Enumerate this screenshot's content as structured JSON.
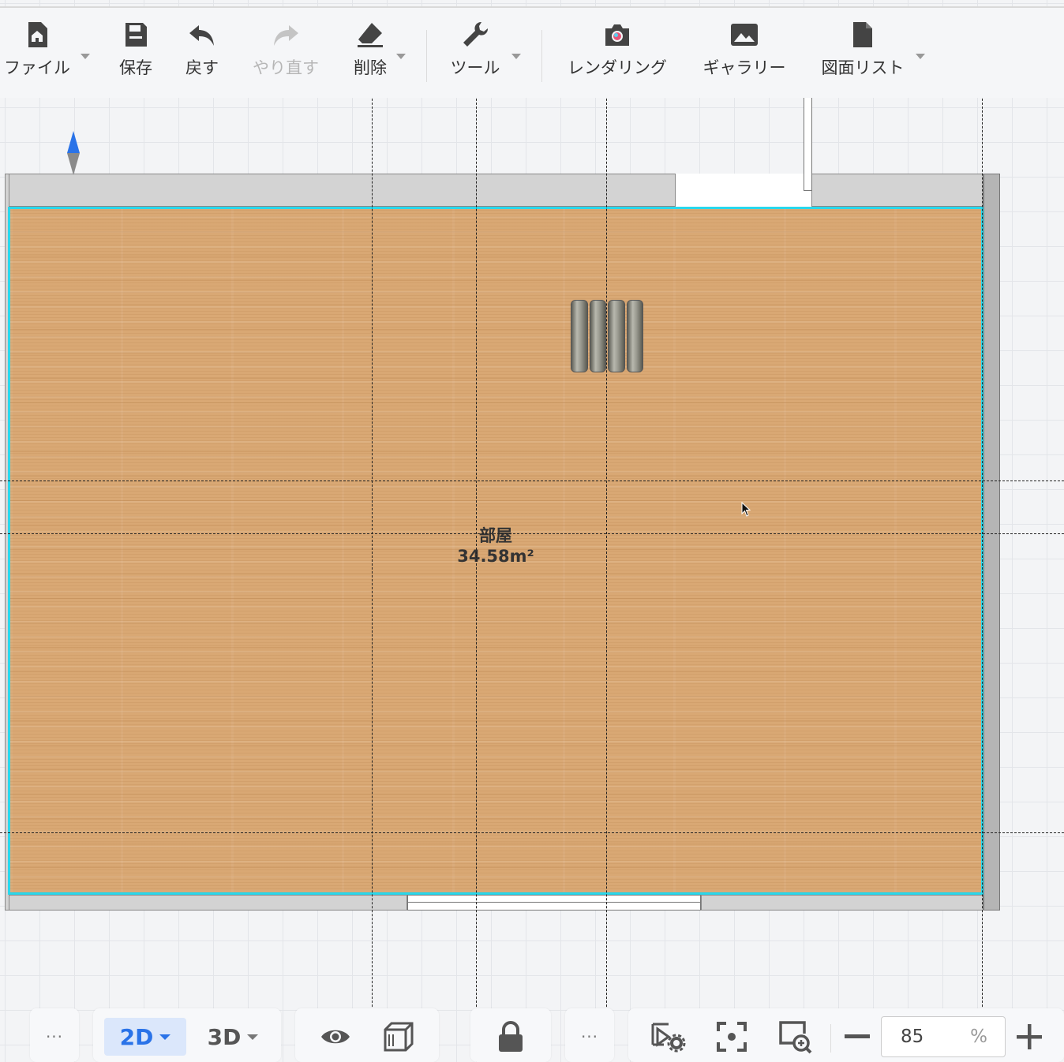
{
  "toolbar": {
    "file": "ファイル",
    "save": "保存",
    "undo": "戻す",
    "redo": "やり直す",
    "delete": "削除",
    "tools": "ツール",
    "rendering": "レンダリング",
    "gallery": "ギャラリー",
    "plan_list": "図面リスト"
  },
  "room": {
    "name": "部屋",
    "area": "34.58m²"
  },
  "bottom_bar": {
    "more_left": "···",
    "view_2d": "2D",
    "view_3d": "3D",
    "more_mid": "···",
    "zoom_value": "85",
    "zoom_unit": "%"
  },
  "colors": {
    "accent": "#2a73e8",
    "room_outline": "#29d8ec",
    "floor": "#d9a874"
  }
}
